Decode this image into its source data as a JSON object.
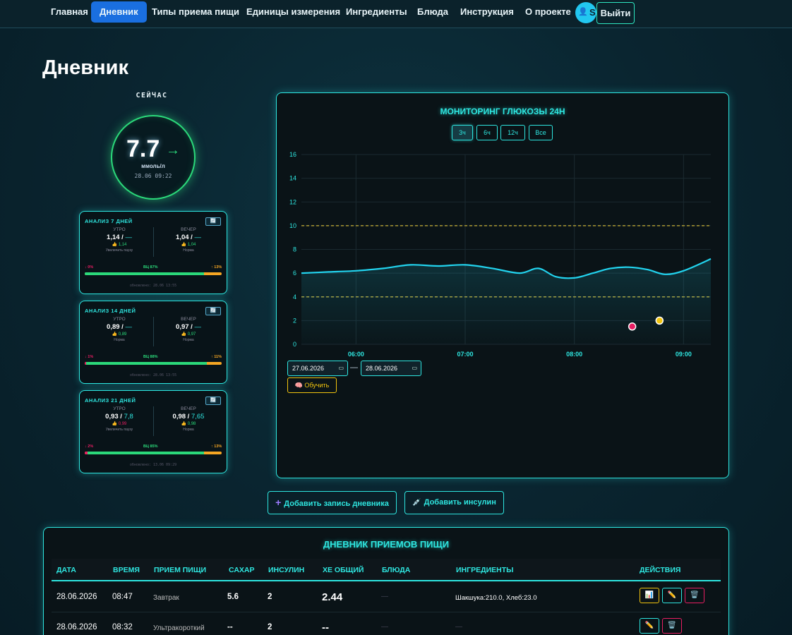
{
  "nav": {
    "items": [
      "Главная",
      "Дневник",
      "Типы приема пищи",
      "Единицы измерения",
      "Ингредиенты",
      "Блюда",
      "Инструкция",
      "О проекте"
    ],
    "active": "Дневник",
    "user_initial": "S",
    "logout_label": "Выйти"
  },
  "page_title": "Дневник",
  "current": {
    "label": "СЕЙЧАС",
    "value": "7.7",
    "trend": "→",
    "unit": "ммоль/л",
    "time": "28.06 09:22"
  },
  "analysis": [
    {
      "title": "АНАЛИЗ 7 ДНЕЙ",
      "btn": "🔄",
      "morning": {
        "label": "УТРО",
        "ratio": "1,14 / ",
        "ratio_hi": "—",
        "advice_value": "👍 1,14",
        "advice": "Увеличить паузу"
      },
      "evening": {
        "label": "ВЕЧЕР",
        "ratio": "1,04 / ",
        "ratio_hi": "—",
        "advice_value": "👍 1,04",
        "advice": "Норма"
      },
      "low_text": "↓ 0%",
      "mid_text": "ВЦ 87%",
      "high_text": "↑ 13%",
      "low": 0,
      "in_range": 87,
      "high": 13,
      "updated": "обновлено: 28.06 13:55"
    },
    {
      "title": "АНАЛИЗ 14 ДНЕЙ",
      "btn": "🔄",
      "morning": {
        "label": "УТРО",
        "ratio": "0,89 / ",
        "ratio_hi": "—",
        "advice_value": "👍 0,89",
        "advice": "Норма"
      },
      "evening": {
        "label": "ВЕЧЕР",
        "ratio": "0,97 / ",
        "ratio_hi": "—",
        "advice_value": "👍 0,97",
        "advice": "Норма"
      },
      "low_text": "↓ 1%",
      "mid_text": "ВЦ 88%",
      "high_text": "↑ 11%",
      "low": 1,
      "in_range": 88,
      "high": 11,
      "updated": "обновлено: 28.06 13:55"
    },
    {
      "title": "АНАЛИЗ 21 ДНЕЙ",
      "btn": "🔄",
      "morning": {
        "label": "УТРО",
        "ratio": "0,93 / ",
        "ratio_hi": "7,8",
        "advice_value": "👍 0,99",
        "advice": "Увеличить паузу"
      },
      "evening": {
        "label": "ВЕЧЕР",
        "ratio": "0,98 / ",
        "ratio_hi": "7,65",
        "advice_value": "👍 0,98",
        "advice": "Норма"
      },
      "low_text": "↓ 2%",
      "mid_text": "ВЦ 85%",
      "high_text": "↑ 13%",
      "low": 2,
      "in_range": 85,
      "high": 13,
      "updated": "обновлено: 13.06 09:29"
    }
  ],
  "chart_card": {
    "title": "МОНИТОРИНГ ГЛЮКОЗЫ 24Н",
    "ranges": [
      "3ч",
      "6ч",
      "12ч",
      "Все"
    ],
    "active_range": "3ч",
    "date_from": "27.06.2026",
    "date_to": "28.06.2026",
    "date_sep": "—",
    "train_label": "🧠 Обучить"
  },
  "chart_data": {
    "type": "line",
    "x_unit": "time of day (hours)",
    "x": [
      5.5,
      5.75,
      6.0,
      6.25,
      6.5,
      6.75,
      7.0,
      7.25,
      7.5,
      7.67,
      7.83,
      8.0,
      8.17,
      8.33,
      8.5,
      8.67,
      8.83,
      9.0,
      9.25
    ],
    "y": [
      6.0,
      6.1,
      6.2,
      6.4,
      6.7,
      6.6,
      6.7,
      6.4,
      6.0,
      6.4,
      5.7,
      5.6,
      6.0,
      6.4,
      6.5,
      6.3,
      5.9,
      6.2,
      7.2
    ],
    "xlim": [
      5.5,
      9.25
    ],
    "ylim": [
      0,
      16
    ],
    "y_ticks": [
      0,
      2,
      4,
      6,
      8,
      10,
      12,
      14,
      16
    ],
    "x_ticks": [
      {
        "v": 6.0,
        "label": "06:00"
      },
      {
        "v": 7.0,
        "label": "07:00"
      },
      {
        "v": 8.0,
        "label": "08:00"
      },
      {
        "v": 9.0,
        "label": "09:00"
      }
    ],
    "thresholds": [
      4,
      10
    ],
    "markers": [
      {
        "x": 8.53,
        "y": 1.5,
        "color": "#e91e63"
      },
      {
        "x": 8.78,
        "y": 2.0,
        "color": "#f1c40f"
      }
    ],
    "line_color": "#22d3ee",
    "threshold_color": "#c9b037",
    "grid": true
  },
  "actions": {
    "add_entry_icon": "+",
    "add_entry": "Добавить запись дневника",
    "add_insulin_icon": "💉",
    "add_insulin": "Добавить инсулин"
  },
  "table": {
    "title": "ДНЕВНИК ПРИЕМОВ ПИЩИ",
    "columns": [
      "ДАТА",
      "ВРЕМЯ",
      "ПРИЕМ ПИЩИ",
      "САХАР",
      "ИНСУЛИН",
      "ХЕ ОБЩИЙ",
      "БЛЮДА",
      "ИНГРЕДИЕНТЫ",
      "ДЕЙСТВИЯ"
    ],
    "rows": [
      {
        "date": "28.06.2026",
        "time": "08:47",
        "meal": "Завтрак",
        "sugar": "5.6",
        "insulin": "2",
        "xe": "2.44",
        "dishes": "—",
        "ingredients": "Шакшука:210.0, Хлеб:23.0"
      },
      {
        "date": "28.06.2026",
        "time": "08:32",
        "meal": "Ультракороткий",
        "sugar": "--",
        "insulin": "2",
        "xe": "--",
        "dishes": "—",
        "ingredients": "—"
      }
    ],
    "icons": {
      "chart": "📊",
      "edit": "✏️",
      "delete": "🗑️"
    }
  }
}
